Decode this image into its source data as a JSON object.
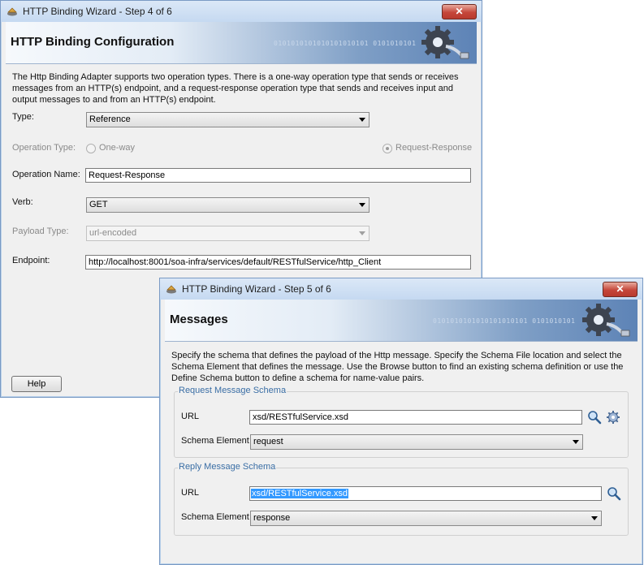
{
  "wizard4": {
    "title": "HTTP Binding Wizard - Step 4 of 6",
    "close_label": "✕",
    "banner_title": "HTTP Binding Configuration",
    "banner_binary": "0101010101010101010101 0101010101",
    "description": "The Http Binding Adapter supports two operation types.  There is a one-way operation type that sends or receives messages from an HTTP(s) endpoint, and a request-response operation type that sends and receives input and output messages to and from an HTTP(s) endpoint.",
    "type_label": "Type:",
    "type_value": "Reference",
    "operation_type_label": "Operation Type:",
    "one_way_label": "One-way",
    "request_response_label": "Request-Response",
    "operation_name_label": "Operation Name:",
    "operation_name_value": "Request-Response",
    "verb_label": "Verb:",
    "verb_value": "GET",
    "payload_type_label": "Payload Type:",
    "payload_type_value": "url-encoded",
    "endpoint_label": "Endpoint:",
    "endpoint_value": "http://localhost:8001/soa-infra/services/default/RESTfulService/http_Client",
    "help_label": "Help"
  },
  "wizard5": {
    "title": "HTTP Binding Wizard - Step 5 of 6",
    "close_label": "✕",
    "banner_title": "Messages",
    "banner_binary": "0101010101010101010101 0101010101",
    "description": "Specify the schema that defines the payload of the Http message.  Specify the Schema File location and select the Schema Element that defines the message. Use the Browse button to find an existing schema definition or use the Define Schema button to define a schema for name-value pairs.",
    "request_group_title": "Request Message Schema",
    "request_url_label": "URL",
    "request_url_value": "xsd/RESTfulService.xsd",
    "request_schema_label": "Schema Element",
    "request_schema_value": "request",
    "reply_group_title": "Reply Message Schema",
    "reply_url_label": "URL",
    "reply_url_value": "xsd/RESTfulService.xsd",
    "reply_schema_label": "Schema Element",
    "reply_schema_value": "response"
  },
  "colors": {
    "title_bar": "#c5d9f1",
    "close_button": "#c5463a",
    "group_title": "#3a6ea5",
    "selection": "#3399ff"
  },
  "icons": [
    "wizard-window-icon",
    "gear-banner-icon",
    "browse-search-icon",
    "define-schema-gear-icon",
    "close-icon"
  ]
}
